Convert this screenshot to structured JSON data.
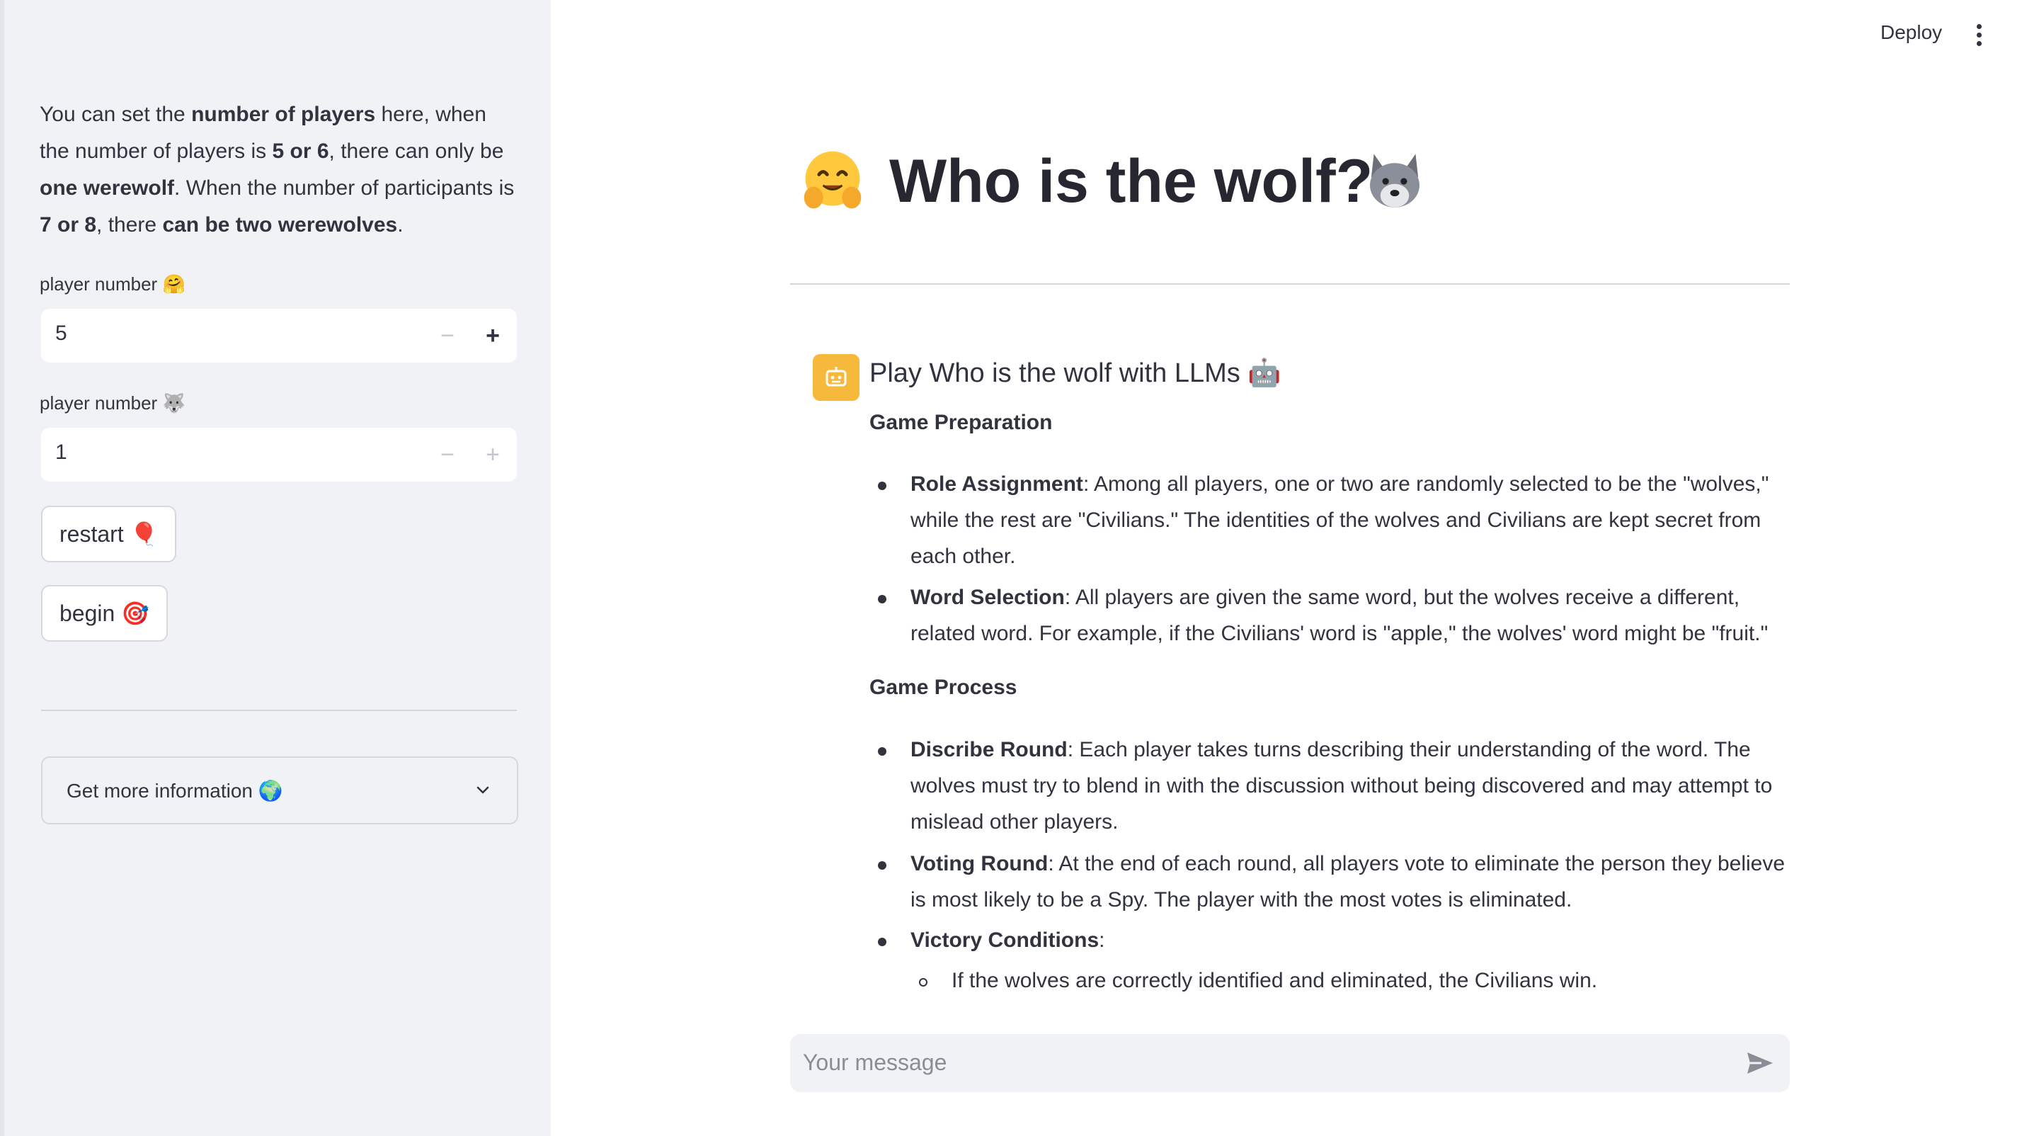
{
  "header": {
    "deploy_label": "Deploy",
    "menu_icon": "kebab-menu-icon"
  },
  "sidebar": {
    "intro": {
      "p1": "You can set the ",
      "b1": "number of players",
      "p2": " here, when the number of players is ",
      "b2": "5 or 6",
      "p3": ", there can only be ",
      "b3": "one werewolf",
      "p4": ". When the number of participants is ",
      "b4": "7 or 8",
      "p5": ", there ",
      "b5": "can be two werewolves",
      "p6": "."
    },
    "input1": {
      "label": "player number",
      "label_emoji": "🤗",
      "value": "5"
    },
    "input2": {
      "label": "player number",
      "label_emoji": "🐺",
      "value": "1"
    },
    "restart_button": {
      "label": "restart",
      "emoji": "🎈"
    },
    "begin_button": {
      "label": "begin",
      "emoji": "🎯"
    },
    "expander": {
      "label": "Get more information",
      "emoji": "🌍"
    }
  },
  "main": {
    "title_emoji_left": "🤗",
    "title": "Who is the wolf?",
    "title_emoji_right": "🐺",
    "chat": {
      "avatar_icon": "bot-icon",
      "title": "Play Who is the wolf with LLMs",
      "title_emoji": "🤖",
      "sections": [
        {
          "heading": "Game Preparation",
          "items": [
            {
              "term": "Role Assignment",
              "text": ": Among all players, one or two are randomly selected to be the \"wolves,\" while the rest are \"Civilians.\" The identities of the wolves and Civilians are kept secret from each other."
            },
            {
              "term": "Word Selection",
              "text": ": All players are given the same word, but the wolves receive a different, related word. For example, if the Civilians' word is \"apple,\" the wolves' word might be \"fruit.\""
            }
          ]
        },
        {
          "heading": "Game Process",
          "items": [
            {
              "term": "Discribe Round",
              "text": ": Each player takes turns describing their understanding of the word. The wolves must try to blend in with the discussion without being discovered and may attempt to mislead other players."
            },
            {
              "term": "Voting Round",
              "text": ": At the end of each round, all players vote to eliminate the person they believe is most likely to be a Spy. The player with the most votes is eliminated."
            },
            {
              "term": "Victory Conditions",
              "text": ":",
              "subitems": [
                "If the wolves are correctly identified and eliminated, the Civilians win."
              ]
            }
          ]
        }
      ]
    },
    "chat_input": {
      "placeholder": "Your message",
      "send_icon": "send-icon"
    }
  }
}
